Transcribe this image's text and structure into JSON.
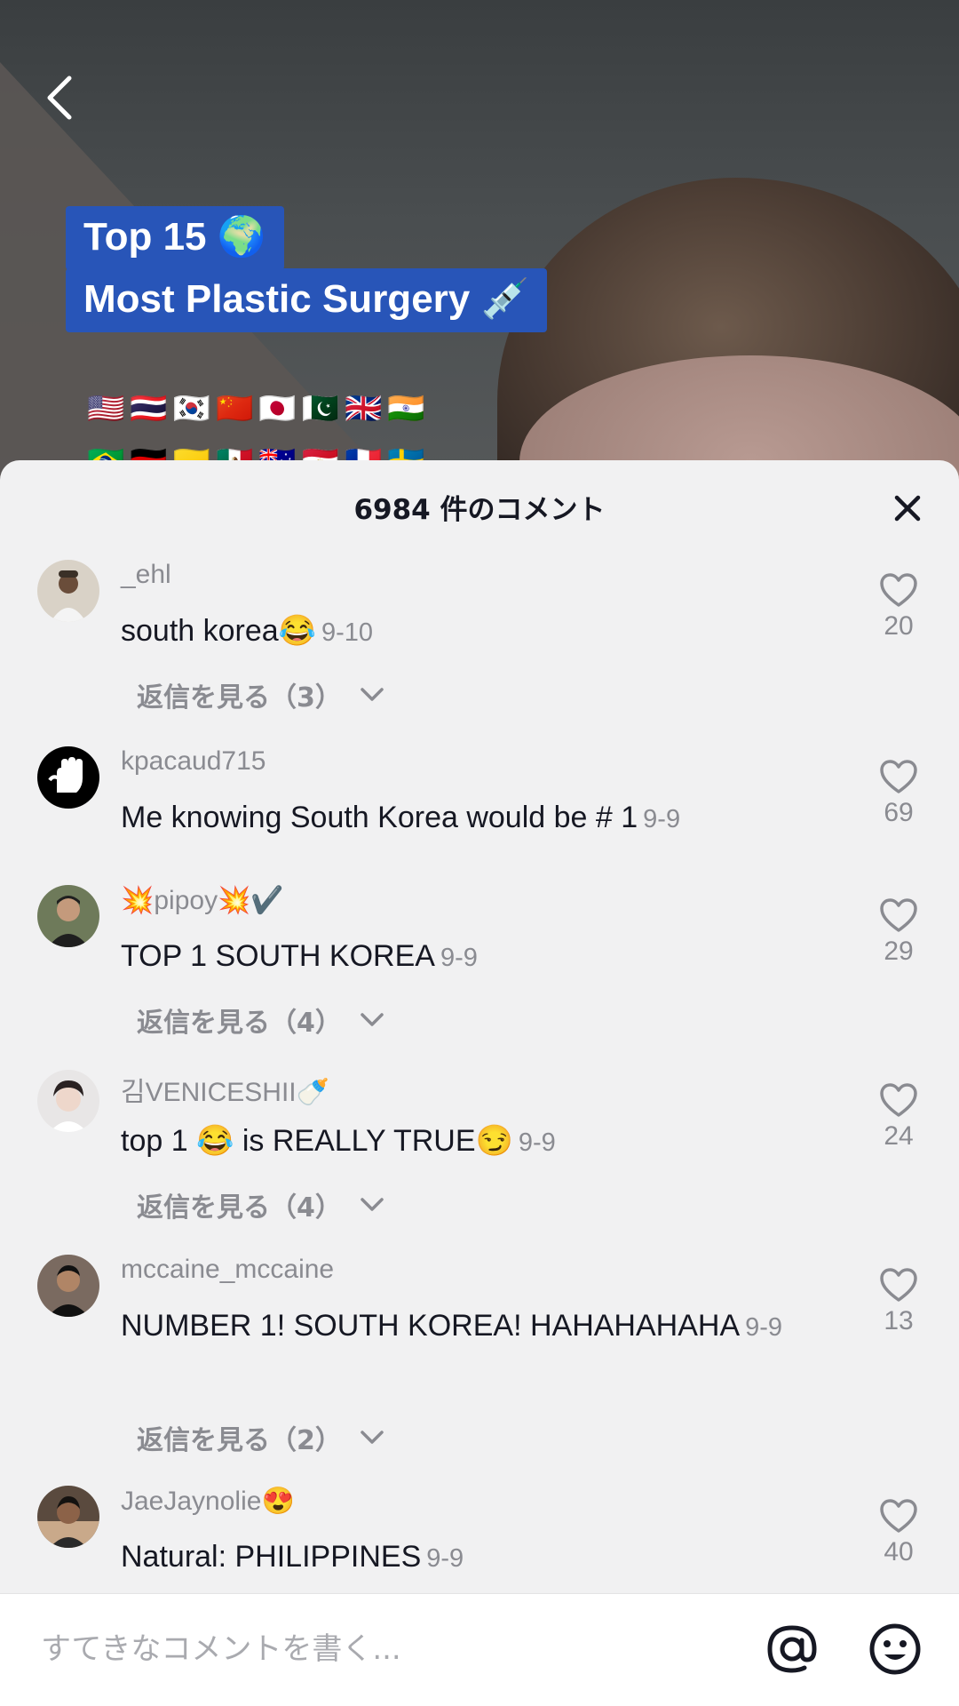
{
  "video": {
    "caption_line1": "Top 15 🌍",
    "caption_line2": "Most Plastic Surgery 💉",
    "flags_row1": "🇺🇸🇹🇭🇰🇷🇨🇳🇯🇵🇵🇰🇬🇧🇮🇳",
    "flags_row2": "🇧🇷🇩🇪🇨🇴🇲🇽🇦🇺🇪🇬🇫🇷🇸🇪"
  },
  "comments_panel": {
    "title": "6984 件のコメント",
    "comments": [
      {
        "username": "_ehl",
        "text": "south korea😂",
        "date": "9-10",
        "likes": "20",
        "replies_label": "返信を見る（3）",
        "avatar_colors": [
          "#d9d2c7",
          "#3a3027"
        ]
      },
      {
        "username": "kpacaud715",
        "text": "Me knowing South Korea would be # 1",
        "date": "9-9",
        "likes": "69",
        "replies_label": "",
        "avatar_colors": [
          "#000000",
          "#ffffff"
        ]
      },
      {
        "username": "💥pipoy💥✔️",
        "text": "TOP 1 SOUTH KOREA",
        "date": "9-9",
        "likes": "29",
        "replies_label": "返信を見る（4）",
        "avatar_colors": [
          "#6e7a5a",
          "#1f1f1f"
        ]
      },
      {
        "username": "김VENICESHII🍼",
        "text": "top 1 😂 is REALLY TRUE😏",
        "date": "9-9",
        "likes": "24",
        "replies_label": "返信を見る（4）",
        "avatar_colors": [
          "#e8e6e6",
          "#2a2222"
        ]
      },
      {
        "username": "mccaine_mccaine",
        "text": "NUMBER 1! SOUTH KOREA! HAHAHAHAHA",
        "date": "9-9",
        "likes": "13",
        "replies_label": "返信を見る（2）",
        "avatar_colors": [
          "#7a6a60",
          "#111111"
        ]
      },
      {
        "username": "JaeJaynolie😍",
        "text": "Natural: PHILIPPINES",
        "date": "9-9",
        "likes": "40",
        "replies_label": "",
        "avatar_colors": [
          "#5a4a3e",
          "#c9a98a"
        ]
      }
    ]
  },
  "input_bar": {
    "placeholder": "すてきなコメントを書く..."
  },
  "icons": {
    "back": "chevron-left-icon",
    "close": "close-icon",
    "like": "heart-outline-icon",
    "expand": "chevron-down-icon",
    "mention": "at-sign-icon",
    "emoji": "smiley-icon"
  },
  "colors": {
    "caption_bg": "#2855b8",
    "sheet_bg": "#f1f1f2",
    "primary_text": "#161823",
    "secondary_text": "#8a8b91"
  }
}
